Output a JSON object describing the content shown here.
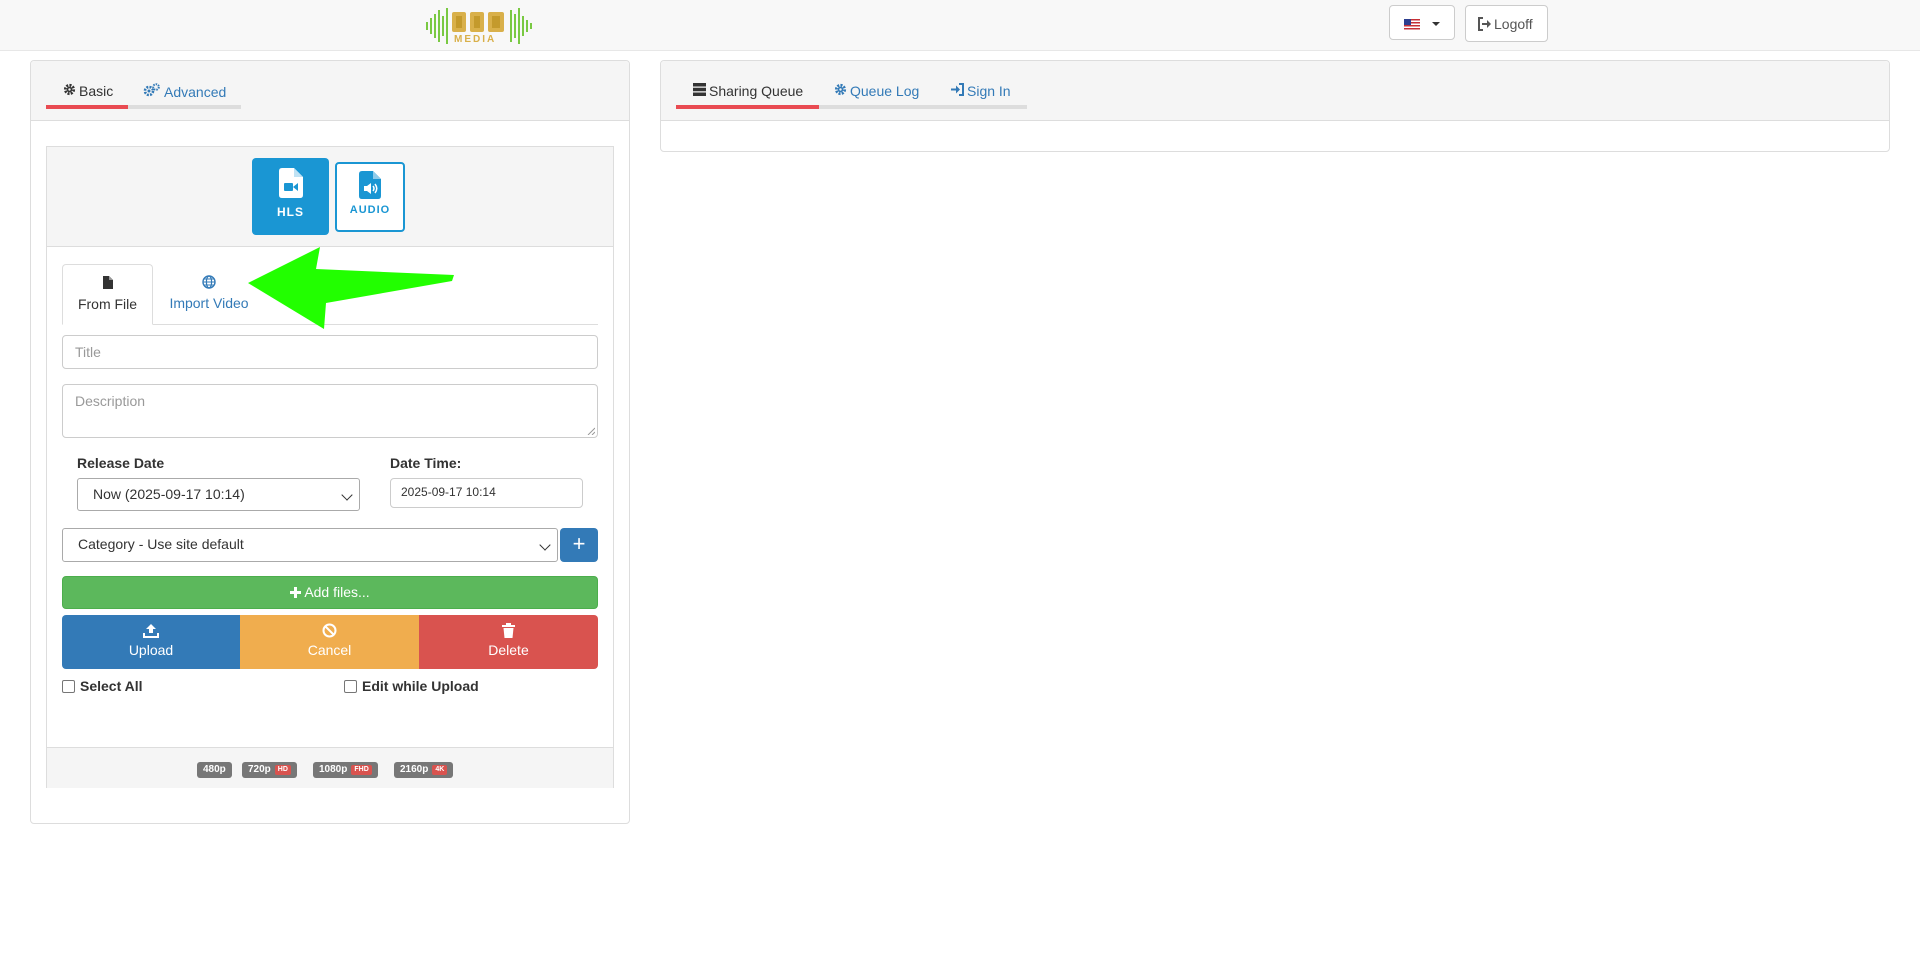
{
  "navbar": {
    "logo_text": "MEDIA",
    "language_icon": "us-flag-icon",
    "logoff_label": "Logoff"
  },
  "left_panel": {
    "tabs": [
      {
        "label": "Basic",
        "icon": "gear-icon",
        "active": true
      },
      {
        "label": "Advanced",
        "icon": "gears-icon",
        "active": false
      }
    ],
    "media_types": [
      {
        "label": "HLS",
        "icon": "video-file-icon",
        "active": true
      },
      {
        "label": "AUDIO",
        "icon": "audio-file-icon",
        "active": false
      }
    ],
    "source_tabs": [
      {
        "label": "From File",
        "icon": "file-icon",
        "active": true
      },
      {
        "label": "Import Video",
        "icon": "globe-icon",
        "active": false
      }
    ],
    "title_placeholder": "Title",
    "description_placeholder": "Description",
    "release_date_label": "Release Date",
    "release_date_value": "Now (2025-09-17 10:14)",
    "date_time_label": "Date Time:",
    "date_time_value": "2025-09-17 10:14",
    "category_value": "Category - Use site default",
    "add_category_label": "+",
    "add_files_label": "Add files...",
    "upload_label": "Upload",
    "cancel_label": "Cancel",
    "delete_label": "Delete",
    "select_all_label": "Select All",
    "edit_while_upload_label": "Edit while Upload",
    "resolutions": [
      {
        "label": "480p",
        "tag": ""
      },
      {
        "label": "720p",
        "tag": "HD"
      },
      {
        "label": "1080p",
        "tag": "FHD"
      },
      {
        "label": "2160p",
        "tag": "4K"
      }
    ]
  },
  "right_panel": {
    "tabs": [
      {
        "label": "Sharing Queue",
        "icon": "server-icon",
        "active": true
      },
      {
        "label": "Queue Log",
        "icon": "gear-icon",
        "active": false
      },
      {
        "label": "Sign In",
        "icon": "sign-in-icon",
        "active": false
      }
    ]
  },
  "colors": {
    "primary": "#337ab7",
    "hls_blue": "#1a96d3",
    "success": "#5cb85c",
    "warning": "#f0ad4e",
    "danger": "#d9534f",
    "active_tab_underline": "#e94b52",
    "annotation_arrow": "#22ff00"
  }
}
